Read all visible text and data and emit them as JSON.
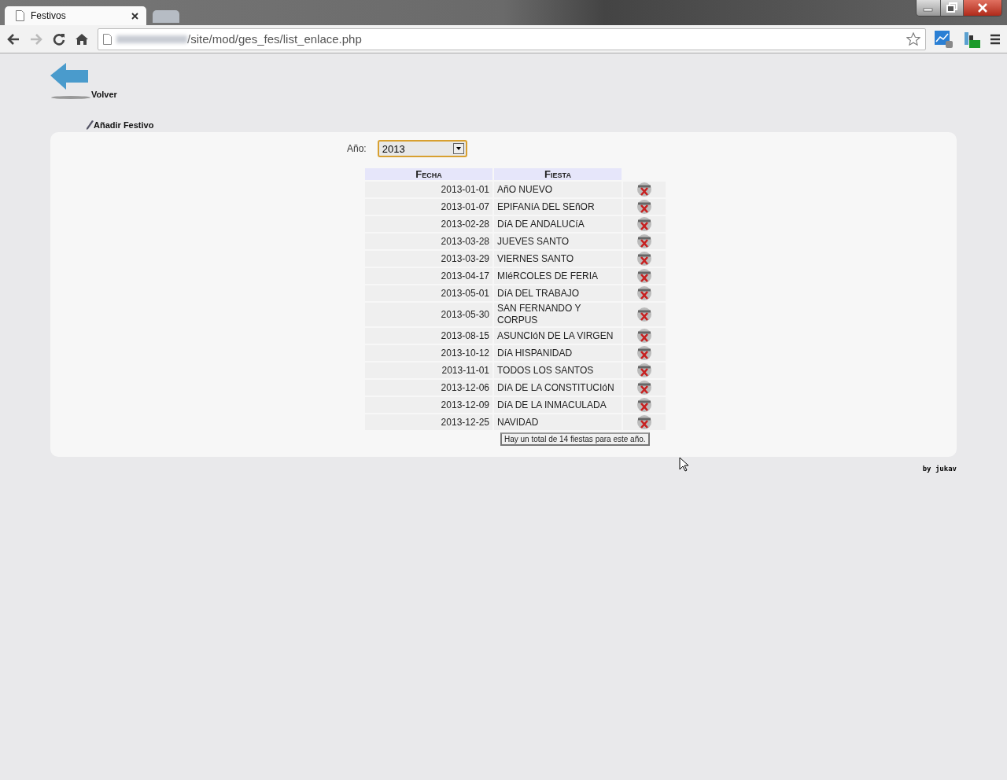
{
  "browser": {
    "tabs": [
      {
        "title": "Festivos",
        "selected": true
      },
      {
        "selected": false
      }
    ],
    "address": "/site/mod/ges_fes/list_enlace.php"
  },
  "page": {
    "back_link": "Volver",
    "add_link": "Añadir Festivo",
    "year_label": "Año:",
    "year_value": "2013",
    "table": {
      "columns": [
        "Fecha",
        "Fiesta"
      ],
      "rows": [
        {
          "date": "2013-01-01",
          "name": "AñO NUEVO"
        },
        {
          "date": "2013-01-07",
          "name": "EPIFANíA DEL SEñOR"
        },
        {
          "date": "2013-02-28",
          "name": "DíA DE ANDALUCíA"
        },
        {
          "date": "2013-03-28",
          "name": "JUEVES SANTO"
        },
        {
          "date": "2013-03-29",
          "name": "VIERNES SANTO"
        },
        {
          "date": "2013-04-17",
          "name": "MIéRCOLES DE FERIA"
        },
        {
          "date": "2013-05-01",
          "name": "DíA DEL TRABAJO"
        },
        {
          "date": "2013-05-30",
          "name": "SAN FERNANDO Y CORPUS"
        },
        {
          "date": "2013-08-15",
          "name": "ASUNCIóN DE LA VIRGEN"
        },
        {
          "date": "2013-10-12",
          "name": "DíA HISPANIDAD"
        },
        {
          "date": "2013-11-01",
          "name": "TODOS LOS SANTOS"
        },
        {
          "date": "2013-12-06",
          "name": "DíA DE LA CONSTITUCIóN"
        },
        {
          "date": "2013-12-09",
          "name": "DíA DE LA INMACULADA"
        },
        {
          "date": "2013-12-25",
          "name": "NAVIDAD"
        }
      ]
    },
    "total_note": "Hay un total de 14 fiestas para este año.",
    "footer": "by jukav"
  }
}
